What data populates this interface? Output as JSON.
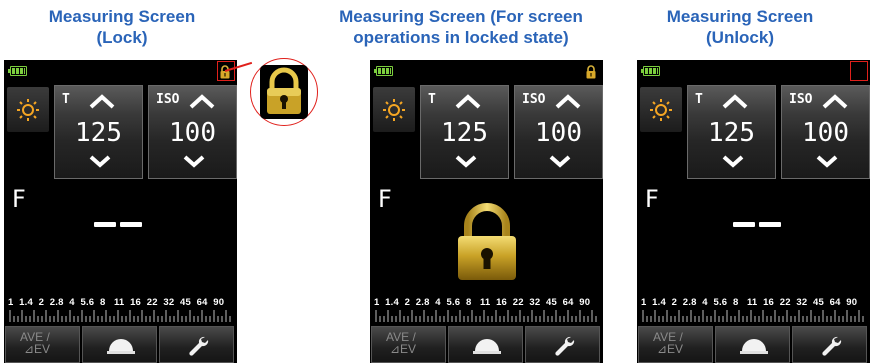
{
  "panels": [
    {
      "title_line1": "Measuring Screen",
      "title_line2": "(Lock)"
    },
    {
      "title_line1": "Measuring Screen (For screen",
      "title_line2": "operations in locked state)"
    },
    {
      "title_line1": "Measuring Screen",
      "title_line2": "(Unlock)"
    }
  ],
  "meter": {
    "t_label": "T",
    "t_value": "125",
    "iso_label": "ISO",
    "iso_value": "100",
    "f_label": "F",
    "aperture_scale": "1  1.4  2  2.8  4  5.6  8   11  16  22  32  45  64  90",
    "ave_line1": "AVE /",
    "ave_line2": "⊿EV"
  },
  "icons": {
    "battery": "battery-icon",
    "lock": "lock-icon",
    "sun": "sun-icon",
    "dome": "dome-icon",
    "wrench": "wrench-icon"
  },
  "colors": {
    "title_blue": "#2a64b8",
    "highlight_red": "#e0201b",
    "lock_gold": "#c9a227",
    "battery_green": "#7ccf3e",
    "sun_orange": "#f5a623"
  }
}
